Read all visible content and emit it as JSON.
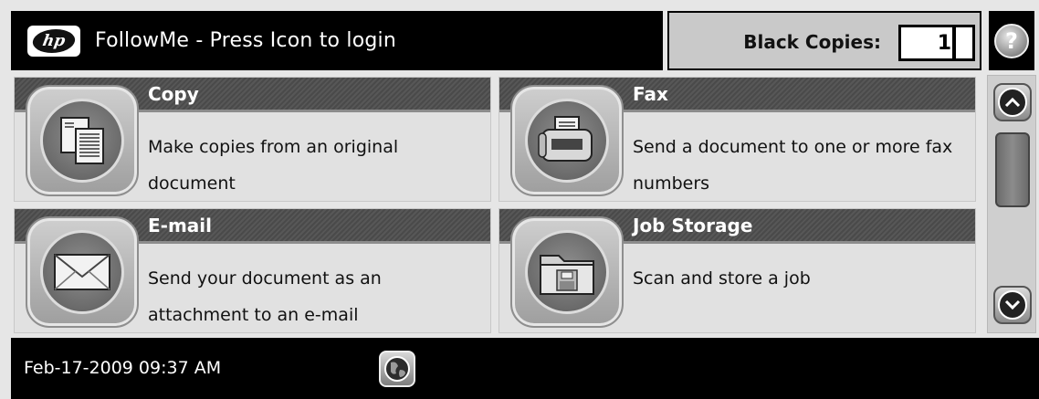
{
  "header": {
    "logo_text": "hp",
    "title": "FollowMe - Press Icon to login",
    "copies_label": "Black Copies:",
    "copies_value": "1",
    "help_symbol": "?",
    "help_icon": "help-icon"
  },
  "tiles": [
    {
      "title": "Copy",
      "description": "Make copies from an original document",
      "icon": "copy-icon"
    },
    {
      "title": "Fax",
      "description": "Send a document to one or more fax numbers",
      "icon": "fax-icon"
    },
    {
      "title": "E-mail",
      "description": "Send your document as an attachment to an e-mail",
      "icon": "email-icon"
    },
    {
      "title": "Job Storage",
      "description": "Scan and store a job",
      "icon": "folder-icon"
    }
  ],
  "scroll": {
    "up_icon": "chevron-up-icon",
    "down_icon": "chevron-down-icon"
  },
  "footer": {
    "datetime": "Feb-17-2009  09:37 AM",
    "globe_icon": "globe-icon"
  },
  "colors": {
    "header_bg": "#000000",
    "tile_head_bg": "#555555",
    "tile_bg": "#e1e1e1",
    "copies_panel_bg": "#c9c9c9"
  }
}
